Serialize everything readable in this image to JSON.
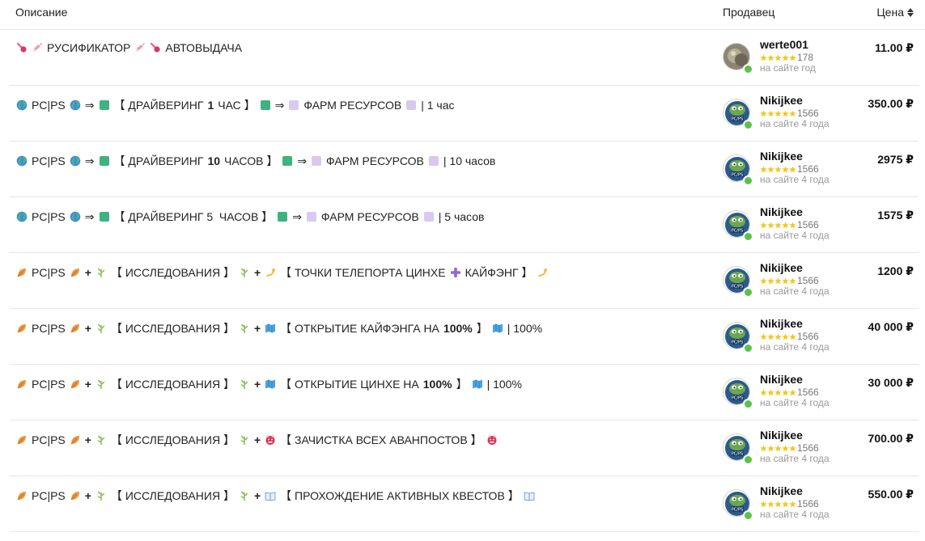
{
  "header": {
    "description": "Описание",
    "seller": "Продавец",
    "price": "Цена"
  },
  "rows": [
    {
      "parts": [
        {
          "t": "icon",
          "n": "comet"
        },
        {
          "t": "icon",
          "n": "syringe"
        },
        {
          "t": "text",
          "v": "РУСИФИКАТОР"
        },
        {
          "t": "icon",
          "n": "syringe"
        },
        {
          "t": "icon",
          "n": "comet"
        },
        {
          "t": "text",
          "v": "АВТОВЫДАЧА"
        }
      ],
      "seller": {
        "name": "werte001",
        "reviews": "178",
        "since": "на сайте год",
        "avatar": "photo"
      },
      "price": "11.00 ₽"
    },
    {
      "parts": [
        {
          "t": "icon",
          "n": "globe"
        },
        {
          "t": "text",
          "v": "PC|PS"
        },
        {
          "t": "icon",
          "n": "globe"
        },
        {
          "t": "text",
          "v": "⇒"
        },
        {
          "t": "icon",
          "n": "green-square"
        },
        {
          "t": "text",
          "v": "【 ДРАЙВЕРИНГ"
        },
        {
          "t": "bold",
          "v": "1"
        },
        {
          "t": "text",
          "v": "ЧАС 】"
        },
        {
          "t": "icon",
          "n": "green-square"
        },
        {
          "t": "text",
          "v": "⇒"
        },
        {
          "t": "icon",
          "n": "purple-square"
        },
        {
          "t": "text",
          "v": "ФАРМ РЕСУРСОВ"
        },
        {
          "t": "icon",
          "n": "purple-square"
        },
        {
          "t": "text",
          "v": "| 1 час"
        }
      ],
      "seller": {
        "name": "Nikijkee",
        "reviews": "1566",
        "since": "на сайте 4 года",
        "avatar": "pepe"
      },
      "price": "350.00 ₽"
    },
    {
      "parts": [
        {
          "t": "icon",
          "n": "globe"
        },
        {
          "t": "text",
          "v": "PC|PS"
        },
        {
          "t": "icon",
          "n": "globe"
        },
        {
          "t": "text",
          "v": "⇒"
        },
        {
          "t": "icon",
          "n": "green-square"
        },
        {
          "t": "text",
          "v": "【 ДРАЙВЕРИНГ"
        },
        {
          "t": "bold",
          "v": "10"
        },
        {
          "t": "text",
          "v": "ЧАСОВ 】"
        },
        {
          "t": "icon",
          "n": "green-square"
        },
        {
          "t": "text",
          "v": "⇒"
        },
        {
          "t": "icon",
          "n": "purple-square"
        },
        {
          "t": "text",
          "v": "ФАРМ РЕСУРСОВ"
        },
        {
          "t": "icon",
          "n": "purple-square"
        },
        {
          "t": "text",
          "v": "| 10 часов"
        }
      ],
      "seller": {
        "name": "Nikijkee",
        "reviews": "1566",
        "since": "на сайте 4 года",
        "avatar": "pepe"
      },
      "price": "2975 ₽"
    },
    {
      "parts": [
        {
          "t": "icon",
          "n": "globe"
        },
        {
          "t": "text",
          "v": "PC|PS"
        },
        {
          "t": "icon",
          "n": "globe"
        },
        {
          "t": "text",
          "v": "⇒"
        },
        {
          "t": "icon",
          "n": "green-square"
        },
        {
          "t": "text",
          "v": "【 ДРАЙВЕРИНГ 5  ЧАСОВ 】"
        },
        {
          "t": "icon",
          "n": "green-square"
        },
        {
          "t": "text",
          "v": "⇒"
        },
        {
          "t": "icon",
          "n": "purple-square"
        },
        {
          "t": "text",
          "v": "ФАРМ РЕСУРСОВ"
        },
        {
          "t": "icon",
          "n": "purple-square"
        },
        {
          "t": "text",
          "v": "| 5 часов"
        }
      ],
      "seller": {
        "name": "Nikijkee",
        "reviews": "1566",
        "since": "на сайте 4 года",
        "avatar": "pepe"
      },
      "price": "1575 ₽"
    },
    {
      "parts": [
        {
          "t": "icon",
          "n": "leaf"
        },
        {
          "t": "text",
          "v": "PC|PS"
        },
        {
          "t": "icon",
          "n": "leaf"
        },
        {
          "t": "bold",
          "v": "+"
        },
        {
          "t": "icon",
          "n": "herb"
        },
        {
          "t": "text",
          "v": "【 ИССЛЕДОВАНИЯ 】"
        },
        {
          "t": "icon",
          "n": "herb"
        },
        {
          "t": "bold",
          "v": "+"
        },
        {
          "t": "icon",
          "n": "dizzy"
        },
        {
          "t": "text",
          "v": "【 ТОЧКИ ТЕЛЕПОРТА ЦИНХЕ"
        },
        {
          "t": "icon",
          "n": "purple-plus"
        },
        {
          "t": "text",
          "v": "КАЙФЭНГ 】"
        },
        {
          "t": "icon",
          "n": "dizzy"
        }
      ],
      "seller": {
        "name": "Nikijkee",
        "reviews": "1566",
        "since": "на сайте 4 года",
        "avatar": "pepe"
      },
      "price": "1200 ₽"
    },
    {
      "parts": [
        {
          "t": "icon",
          "n": "leaf"
        },
        {
          "t": "text",
          "v": "PC|PS"
        },
        {
          "t": "icon",
          "n": "leaf"
        },
        {
          "t": "bold",
          "v": "+"
        },
        {
          "t": "icon",
          "n": "herb"
        },
        {
          "t": "text",
          "v": "【 ИССЛЕДОВАНИЯ 】"
        },
        {
          "t": "icon",
          "n": "herb"
        },
        {
          "t": "bold",
          "v": "+"
        },
        {
          "t": "icon",
          "n": "map"
        },
        {
          "t": "text",
          "v": "【 ОТКРЫТИЕ КАЙФЭНГА НА"
        },
        {
          "t": "bold",
          "v": "100%"
        },
        {
          "t": "text",
          "v": "】"
        },
        {
          "t": "icon",
          "n": "map"
        },
        {
          "t": "text",
          "v": "| 100%"
        }
      ],
      "seller": {
        "name": "Nikijkee",
        "reviews": "1566",
        "since": "на сайте 4 года",
        "avatar": "pepe"
      },
      "price": "40 000 ₽"
    },
    {
      "parts": [
        {
          "t": "icon",
          "n": "leaf"
        },
        {
          "t": "text",
          "v": "PC|PS"
        },
        {
          "t": "icon",
          "n": "leaf"
        },
        {
          "t": "bold",
          "v": "+"
        },
        {
          "t": "icon",
          "n": "herb"
        },
        {
          "t": "text",
          "v": "【 ИССЛЕДОВАНИЯ 】"
        },
        {
          "t": "icon",
          "n": "herb"
        },
        {
          "t": "bold",
          "v": "+"
        },
        {
          "t": "icon",
          "n": "map"
        },
        {
          "t": "text",
          "v": "【 ОТКРЫТИЕ ЦИНХЕ НА"
        },
        {
          "t": "bold",
          "v": "100%"
        },
        {
          "t": "text",
          "v": "】"
        },
        {
          "t": "icon",
          "n": "map"
        },
        {
          "t": "text",
          "v": "| 100%"
        }
      ],
      "seller": {
        "name": "Nikijkee",
        "reviews": "1566",
        "since": "на сайте 4 года",
        "avatar": "pepe"
      },
      "price": "30 000 ₽"
    },
    {
      "parts": [
        {
          "t": "icon",
          "n": "leaf"
        },
        {
          "t": "text",
          "v": "PC|PS"
        },
        {
          "t": "icon",
          "n": "leaf"
        },
        {
          "t": "bold",
          "v": "+"
        },
        {
          "t": "icon",
          "n": "herb"
        },
        {
          "t": "text",
          "v": "【 ИССЛЕДОВАНИЯ 】"
        },
        {
          "t": "icon",
          "n": "herb"
        },
        {
          "t": "bold",
          "v": "+"
        },
        {
          "t": "icon",
          "n": "ogre"
        },
        {
          "t": "text",
          "v": "【 ЗАЧИСТКА ВСЕХ АВАНПОСТОВ 】"
        },
        {
          "t": "icon",
          "n": "ogre"
        }
      ],
      "seller": {
        "name": "Nikijkee",
        "reviews": "1566",
        "since": "на сайте 4 года",
        "avatar": "pepe"
      },
      "price": "700.00 ₽"
    },
    {
      "parts": [
        {
          "t": "icon",
          "n": "leaf"
        },
        {
          "t": "text",
          "v": "PC|PS"
        },
        {
          "t": "icon",
          "n": "leaf"
        },
        {
          "t": "bold",
          "v": "+"
        },
        {
          "t": "icon",
          "n": "herb"
        },
        {
          "t": "text",
          "v": "【 ИССЛЕДОВАНИЯ 】"
        },
        {
          "t": "icon",
          "n": "herb"
        },
        {
          "t": "bold",
          "v": "+"
        },
        {
          "t": "icon",
          "n": "book"
        },
        {
          "t": "text",
          "v": "【 ПРОХОЖДЕНИЕ АКТИВНЫХ КВЕСТОВ 】"
        },
        {
          "t": "icon",
          "n": "book"
        }
      ],
      "seller": {
        "name": "Nikijkee",
        "reviews": "1566",
        "since": "на сайте 4 года",
        "avatar": "pepe"
      },
      "price": "550.00 ₽"
    }
  ],
  "colors": {
    "online": "#5cc14b",
    "star": "#f5c518",
    "border": "#e6e6e6"
  }
}
